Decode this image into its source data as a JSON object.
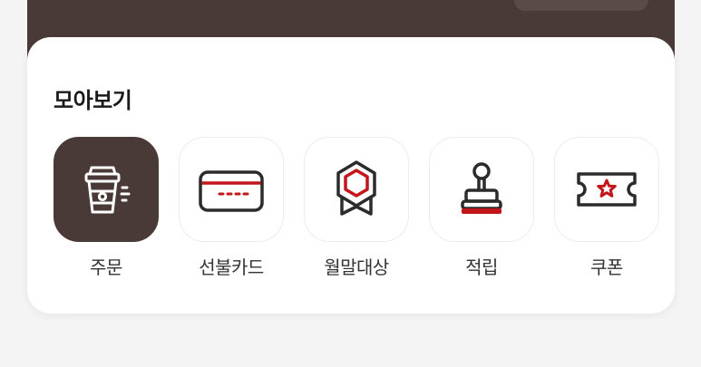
{
  "section_title": "모아보기",
  "colors": {
    "brand_brown": "#4a3a37",
    "accent_red": "#c2161b",
    "icon_dark": "#2b2b2b"
  },
  "shortcuts": [
    {
      "label": "주문",
      "icon": "takeout-cup-icon",
      "active": true
    },
    {
      "label": "선불카드",
      "icon": "card-icon",
      "active": false
    },
    {
      "label": "월말대상",
      "icon": "medal-badge-icon",
      "active": false
    },
    {
      "label": "적립",
      "icon": "stamp-icon",
      "active": false
    },
    {
      "label": "쿠폰",
      "icon": "coupon-ticket-icon",
      "active": false
    }
  ]
}
